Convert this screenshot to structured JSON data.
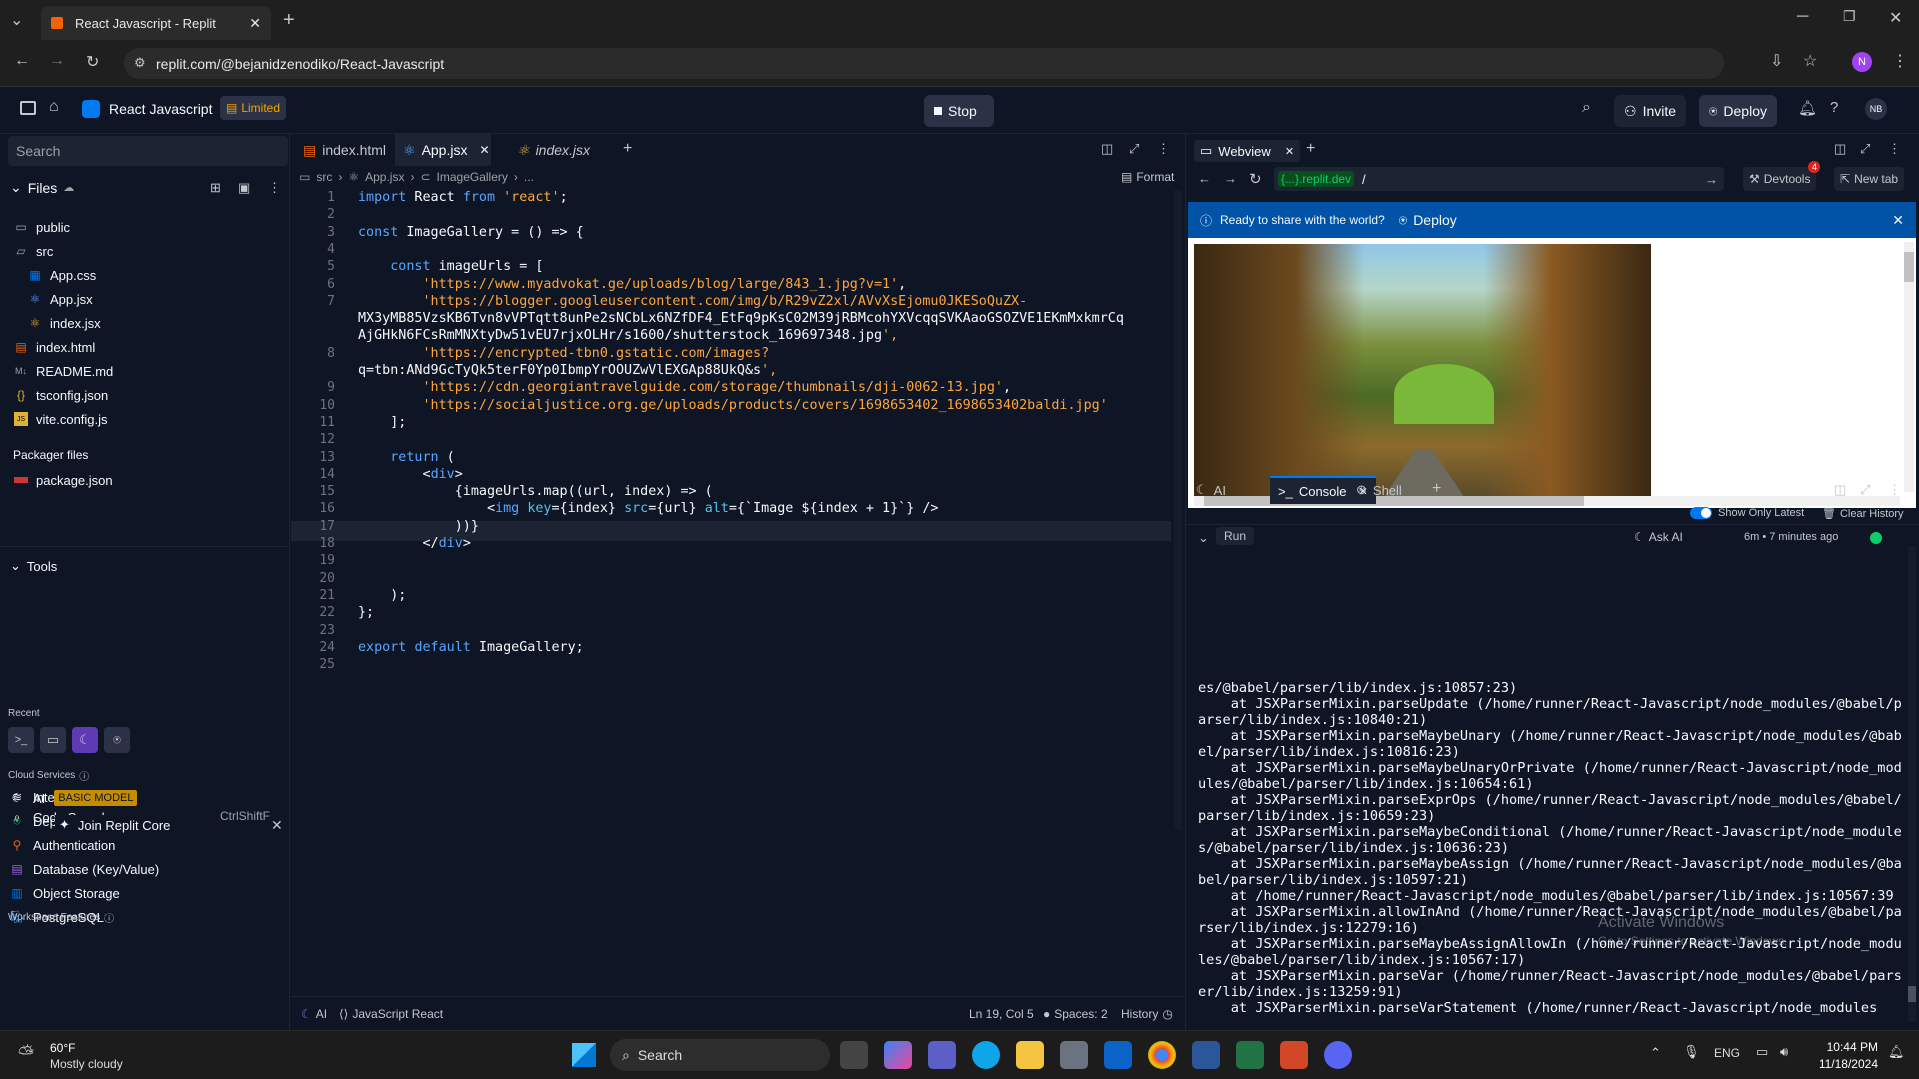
{
  "browser": {
    "tab_title": "React Javascript - Replit",
    "url": "replit.com/@bejanidzenodiko/React-Javascript",
    "profile": "N"
  },
  "header": {
    "project": "React Javascript",
    "plan": "Limited",
    "stop": "Stop",
    "invite": "Invite",
    "deploy": "Deploy",
    "avatar": "NB"
  },
  "sidebar": {
    "search": "Search",
    "files_label": "Files",
    "files": [
      {
        "name": "public",
        "icon": "folder-icon"
      },
      {
        "name": "src",
        "icon": "folder-open-icon"
      },
      {
        "name": "App.css",
        "icon": "css-file-icon"
      },
      {
        "name": "App.jsx",
        "icon": "react-file-icon"
      },
      {
        "name": "index.jsx",
        "icon": "react-file-icon"
      },
      {
        "name": "index.html",
        "icon": "html-file-icon"
      },
      {
        "name": "README.md",
        "icon": "markdown-icon"
      },
      {
        "name": "tsconfig.json",
        "icon": "json-icon"
      },
      {
        "name": "vite.config.js",
        "icon": "js-file-icon"
      }
    ],
    "packager_label": "Packager files",
    "packager_file": "package.json",
    "tools_label": "Tools",
    "recent_label": "Recent",
    "cloud_label": "Cloud Services",
    "cloud": [
      "Integrations",
      "Deployments",
      "Authentication",
      "Database (Key/Value)",
      "Object Storage",
      "PostgreSQL"
    ],
    "workspace_label": "Workspace Features",
    "ai": "AI",
    "ai_badge": "BASIC MODEL",
    "code_search": "Code Search",
    "shortcut": "CtrlShiftF",
    "join": "Join Replit Core"
  },
  "editor": {
    "tabs": [
      "index.html",
      "App.jsx",
      "index.jsx"
    ],
    "breadcrumb": [
      "src",
      "App.jsx",
      "ImageGallery",
      "..."
    ],
    "format": "Format",
    "lines": [
      "import React from 'react';",
      "",
      "const ImageGallery = () => {",
      "",
      "    const imageUrls = [",
      "        'https://www.myadvokat.ge/uploads/blog/large/843_1.jpg?v=1',",
      "        'https://blogger.googleusercontent.com/img/b/R29vZ2xl/AVvXsEjomu0JKESoQuZX-",
      "MX3yMB85VzsKB6Tvn8vVPTqtt8unPe2sNCbLx6NZfDF4_EtFq9pKsC02M39jRBMcohYXVcqqSVKAaoGSOZVE1EKmMxkmrCq",
      "AjGHkN6FCsRmMNXtyDw51vEU7rjxOLHr/s1600/shutterstock_169697348.jpg',",
      "        'https://encrypted-tbn0.gstatic.com/images?",
      "q=tbn:ANd9GcTyQk5terF0Yp0IbmpYrOOUZwVlEXGAp88UkQ&s',",
      "        'https://cdn.georgiantravelguide.com/storage/thumbnails/dji-0062-13.jpg',",
      "        'https://socialjustice.org.ge/uploads/products/covers/1698653402_1698653402baldi.jpg'",
      "    ];",
      "",
      "    return (",
      "        <div>",
      "            {imageUrls.map((url, index) => (",
      "                <img key={index} src={url} alt={`Image ${index + 1}`} />",
      "            ))}",
      "        </div>",
      "",
      "",
      "    );",
      "};",
      "",
      "export default ImageGallery;",
      ""
    ],
    "line_numbers": [
      "1",
      "2",
      "3",
      "4",
      "5",
      "6",
      "7",
      "",
      "",
      "8",
      "",
      "9",
      "10",
      "11",
      "12",
      "13",
      "14",
      "15",
      "16",
      "17",
      "18",
      "19",
      "20",
      "21",
      "22",
      "23",
      "24",
      "25"
    ],
    "status": {
      "ai": "AI",
      "lang": "JavaScript React",
      "pos": "Ln 19, Col 5",
      "spaces": "Spaces: 2",
      "history": "History"
    }
  },
  "webview": {
    "tab": "Webview",
    "url_host": "{...}.replit.dev",
    "url_path": "/",
    "devtools": "Devtools",
    "devtools_badge": "4",
    "newtab": "New tab",
    "banner_text": "Ready to share with the world?",
    "banner_button": "Deploy"
  },
  "console": {
    "tabs": [
      "AI",
      "Console",
      "Shell"
    ],
    "show_latest": "Show Only Latest",
    "clear": "Clear History",
    "run": "Run",
    "ask_ai": "Ask AI",
    "time": "6m • 7 minutes ago",
    "output": "es/@babel/parser/lib/index.js:10857:23)\n    at JSXParserMixin.parseUpdate (/home/runner/React-Javascript/node_modules/@babel/parser/lib/index.js:10840:21)\n    at JSXParserMixin.parseMaybeUnary (/home/runner/React-Javascript/node_modules/@babel/parser/lib/index.js:10816:23)\n    at JSXParserMixin.parseMaybeUnaryOrPrivate (/home/runner/React-Javascript/node_modules/@babel/parser/lib/index.js:10654:61)\n    at JSXParserMixin.parseExprOps (/home/runner/React-Javascript/node_modules/@babel/parser/lib/index.js:10659:23)\n    at JSXParserMixin.parseMaybeConditional (/home/runner/React-Javascript/node_modules/@babel/parser/lib/index.js:10636:23)\n    at JSXParserMixin.parseMaybeAssign (/home/runner/React-Javascript/node_modules/@babel/parser/lib/index.js:10597:21)\n    at /home/runner/React-Javascript/node_modules/@babel/parser/lib/index.js:10567:39\n    at JSXParserMixin.allowInAnd (/home/runner/React-Javascript/node_modules/@babel/parser/lib/index.js:12279:16)\n    at JSXParserMixin.parseMaybeAssignAllowIn (/home/runner/React-Javascript/node_modules/@babel/parser/lib/index.js:10567:17)\n    at JSXParserMixin.parseVar (/home/runner/React-Javascript/node_modules/@babel/parser/lib/index.js:13259:91)\n    at JSXParserMixin.parseVarStatement (/home/runner/React-Javascript/node_modules",
    "watermark_1": "Activate Windows",
    "watermark_2": "Go to Settings to activate Windows."
  },
  "taskbar": {
    "temp": "60°F",
    "weather": "Mostly cloudy",
    "search": "Search",
    "time": "10:44 PM",
    "date": "11/18/2024",
    "lang": "ENG"
  },
  "colors": {
    "accent": "#0079f2",
    "banner": "#0053a6",
    "limited": "#f0a500",
    "ai_badge": "#c68c00"
  }
}
